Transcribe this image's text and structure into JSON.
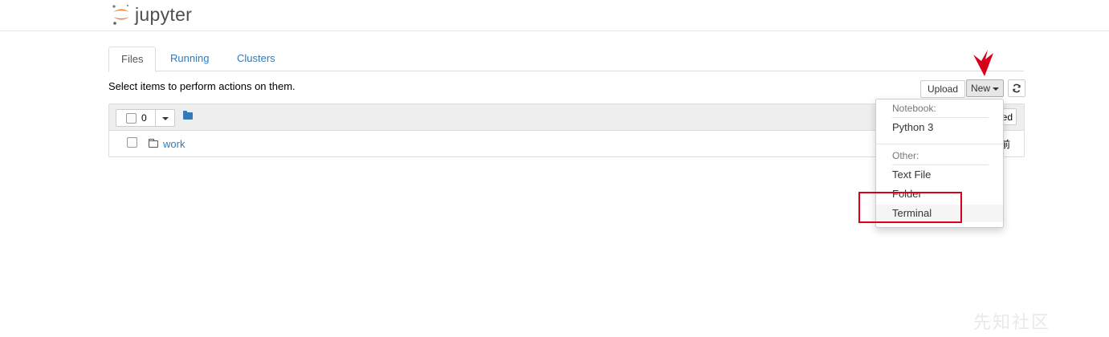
{
  "header": {
    "logo_text": "jupyter",
    "logo_colors": [
      "#f37726",
      "#767677",
      "#989798"
    ]
  },
  "tabs": [
    {
      "label": "Files",
      "active": true
    },
    {
      "label": "Running",
      "active": false
    },
    {
      "label": "Clusters",
      "active": false
    }
  ],
  "toolbar": {
    "hint": "Select items to perform actions on them.",
    "upload_label": "Upload",
    "new_label": "New",
    "refresh_icon": "refresh-icon"
  },
  "list": {
    "selected_count": "0",
    "header_right_partial": "ed",
    "rows": [
      {
        "name": "work",
        "type": "folder",
        "modified_partial": "前"
      }
    ]
  },
  "new_menu": {
    "notebook_header": "Notebook:",
    "notebook_items": [
      "Python 3"
    ],
    "other_header": "Other:",
    "other_items": [
      "Text File",
      "Folder",
      "Terminal"
    ],
    "highlighted": "Terminal"
  },
  "annotations": {
    "arrow_color": "#d9001b",
    "box_color": "#d9001b"
  },
  "watermark": "先知社区"
}
